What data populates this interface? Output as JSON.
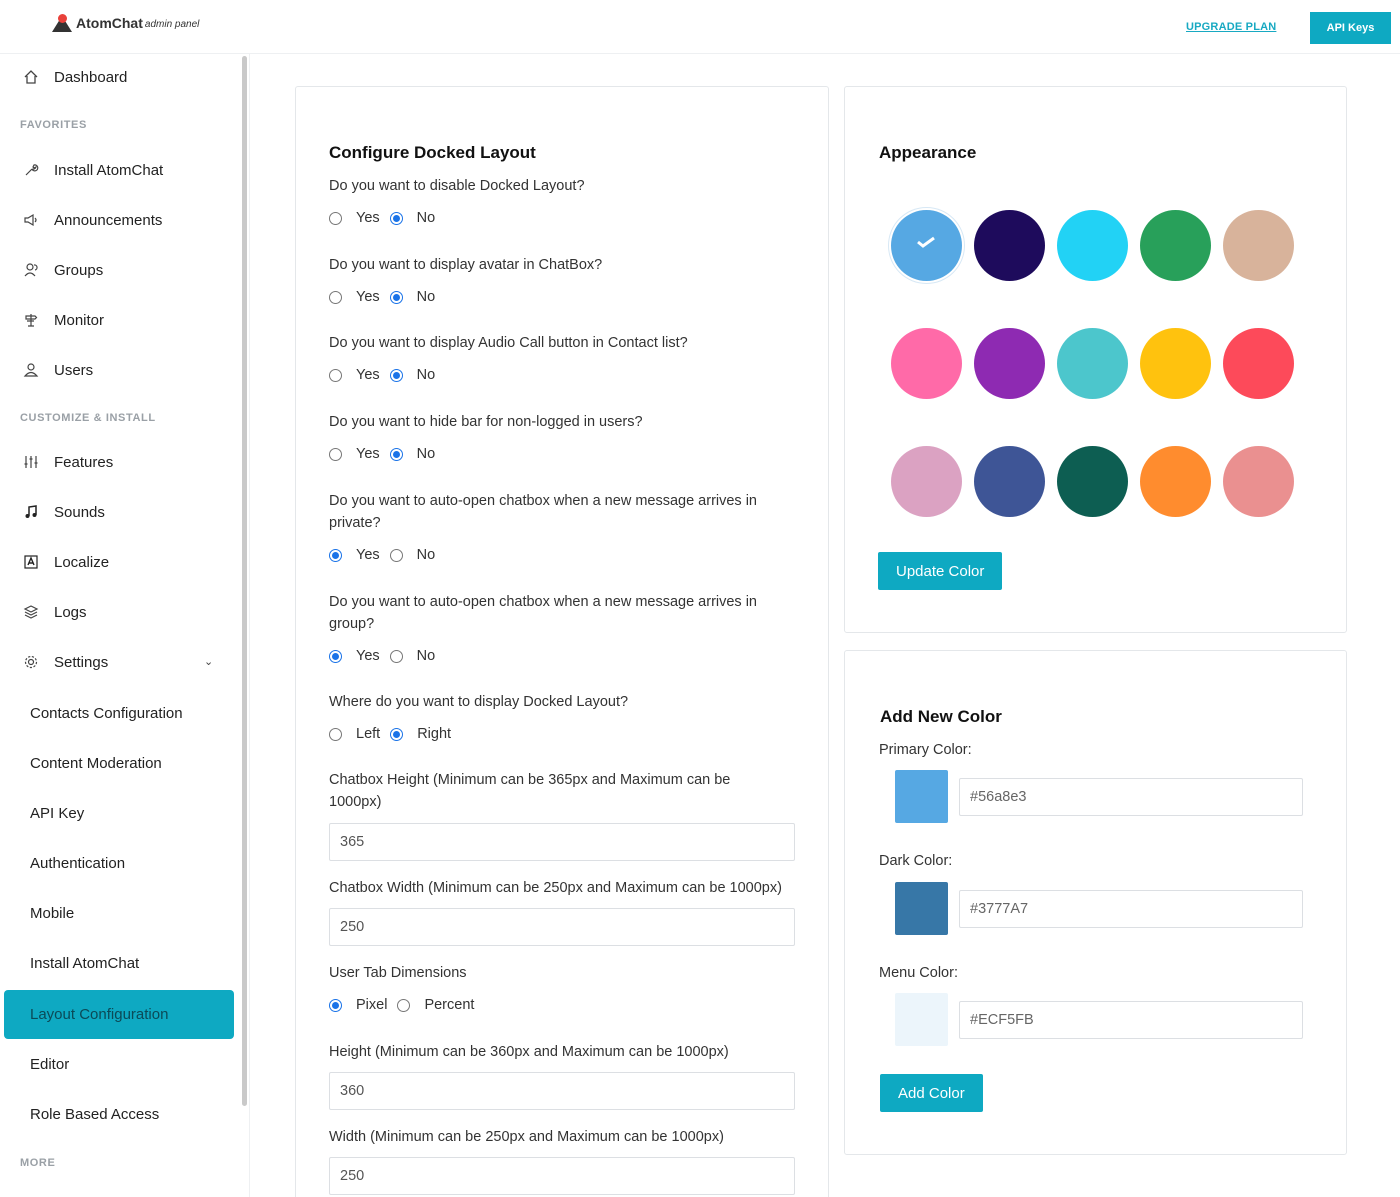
{
  "header": {
    "logo_name": "AtomChat",
    "logo_sub": "admin panel",
    "upgrade_label": "UPGRADE PLAN",
    "api_keys_label": "API Keys"
  },
  "sidebar": {
    "dashboard": "Dashboard",
    "section_favorites": "FAVORITES",
    "favorites": [
      "Install AtomChat",
      "Announcements",
      "Groups",
      "Monitor",
      "Users"
    ],
    "section_customize": "CUSTOMIZE & INSTALL",
    "customize": [
      "Features",
      "Sounds",
      "Localize",
      "Logs",
      "Settings"
    ],
    "settings_sub": [
      "Contacts Configuration",
      "Content Moderation",
      "API Key",
      "Authentication",
      "Mobile",
      "Install AtomChat",
      "Layout Configuration",
      "Editor",
      "Role Based Access"
    ],
    "section_more": "MORE"
  },
  "docked": {
    "title": "Configure Docked Layout",
    "q1": "Do you want to disable Docked Layout?",
    "q2": "Do you want to display avatar in ChatBox?",
    "q3": "Do you want to display Audio Call button in Contact list?",
    "q4": "Do you want to hide bar for non-logged in users?",
    "q5": "Do you want to auto-open chatbox when a new message arrives in private?",
    "q6": "Do you want to auto-open chatbox when a new message arrives in group?",
    "q7": "Where do you want to display Docked Layout?",
    "yes": "Yes",
    "no": "No",
    "left": "Left",
    "right": "Right",
    "chatbox_height_label": "Chatbox Height (Minimum can be 365px and Maximum can be 1000px)",
    "chatbox_height_value": "365",
    "chatbox_width_label": "Chatbox Width (Minimum can be 250px and Maximum can be 1000px)",
    "chatbox_width_value": "250",
    "user_tab_label": "User Tab Dimensions",
    "pixel": "Pixel",
    "percent": "Percent",
    "height_label": "Height (Minimum can be 360px and Maximum can be 1000px)",
    "height_value": "360",
    "width_label": "Width (Minimum can be 250px and Maximum can be 1000px)",
    "width_value": "250"
  },
  "appearance": {
    "title": "Appearance",
    "swatches": [
      "#56a8e3",
      "#1e0b5c",
      "#22d2f5",
      "#28a05a",
      "#d8b39b",
      "#ff6aa8",
      "#8e2ab2",
      "#4cc6cc",
      "#ffc20e",
      "#fd4a5a",
      "#dba2c2",
      "#3e5596",
      "#0d5e52",
      "#ff8c2e",
      "#ea9090"
    ],
    "selected_index": 0,
    "update_label": "Update Color"
  },
  "add_color": {
    "title": "Add New Color",
    "primary_label": "Primary Color:",
    "primary_value": "#56a8e3",
    "primary_color": "#56a8e3",
    "dark_label": "Dark Color:",
    "dark_value": "#3777A7",
    "dark_color": "#3777A7",
    "menu_label": "Menu Color:",
    "menu_value": "#ECF5FB",
    "menu_color": "#ECF5FB",
    "add_label": "Add Color"
  }
}
